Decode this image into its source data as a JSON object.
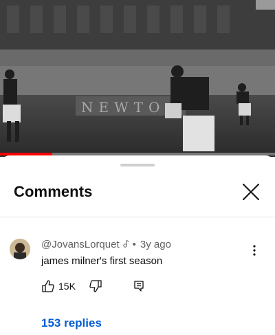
{
  "video": {
    "progress": 0.19,
    "accent_color": "#ff0000",
    "banner_text": "NEWTO"
  },
  "comments_panel": {
    "title": "Comments",
    "close_icon": "close-icon"
  },
  "comment": {
    "author": "@JovansLorquet",
    "separator": "•",
    "age": "3y ago",
    "text": "james milner's first season",
    "like_count": "15K",
    "replies_label": "153 replies",
    "link_color": "#065fd4"
  }
}
